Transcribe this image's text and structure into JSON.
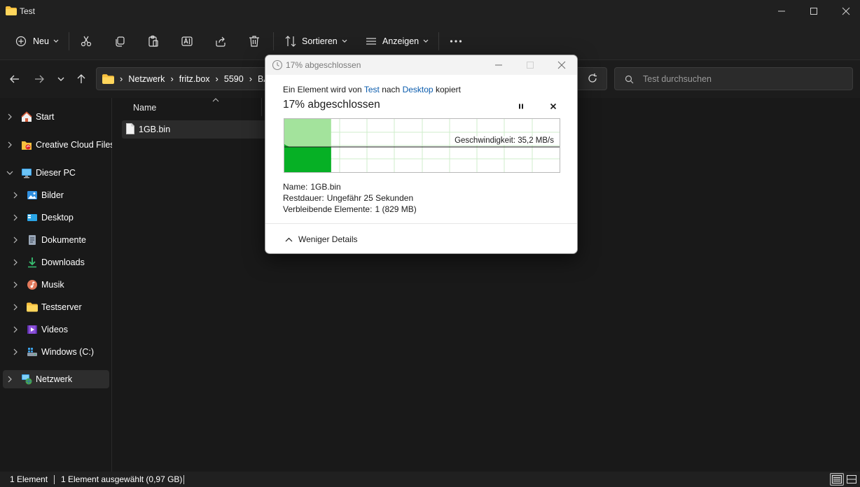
{
  "window": {
    "title": "Test",
    "controls": [
      "minimize",
      "maximize",
      "close"
    ]
  },
  "toolbar": {
    "new_label": "Neu",
    "sort_label": "Sortieren",
    "view_label": "Anzeigen",
    "icons": [
      "cut-icon",
      "copy-icon",
      "paste-icon",
      "rename-icon",
      "share-icon",
      "delete-icon",
      "more-icon"
    ]
  },
  "address": {
    "crumbs": [
      "Netzwerk",
      "fritz.box",
      "5590",
      "BA"
    ]
  },
  "search": {
    "placeholder": "Test durchsuchen"
  },
  "sidebar": {
    "items": [
      {
        "label": "Start",
        "icon": "home-icon",
        "level": 0
      },
      {
        "label": "Creative Cloud Files",
        "icon": "creative-cloud-folder-icon",
        "level": 0
      },
      {
        "label": "Dieser PC",
        "icon": "pc-icon",
        "level": 0,
        "expanded": true
      },
      {
        "label": "Bilder",
        "icon": "pictures-icon",
        "level": 1
      },
      {
        "label": "Desktop",
        "icon": "desktop-icon",
        "level": 1
      },
      {
        "label": "Dokumente",
        "icon": "documents-icon",
        "level": 1
      },
      {
        "label": "Downloads",
        "icon": "downloads-icon",
        "level": 1
      },
      {
        "label": "Musik",
        "icon": "music-icon",
        "level": 1
      },
      {
        "label": "Testserver",
        "icon": "folder-icon",
        "level": 1
      },
      {
        "label": "Videos",
        "icon": "videos-icon",
        "level": 1
      },
      {
        "label": "Windows (C:)",
        "icon": "drive-icon",
        "level": 1
      },
      {
        "label": "Netzwerk",
        "icon": "network-icon",
        "level": 0,
        "selected": true
      }
    ]
  },
  "content": {
    "column_name": "Name",
    "files": [
      {
        "name": "1GB.bin",
        "selected": true
      }
    ]
  },
  "statusbar": {
    "count": "1 Element",
    "selection": "1 Element ausgewählt (0,97 GB)"
  },
  "dialog": {
    "title": "17% abgeschlossen",
    "line_prefix": "Ein Element wird von",
    "source": "Test",
    "line_mid": "nach",
    "destination": "Desktop",
    "line_suffix": "kopiert",
    "heading": "17% abgeschlossen",
    "progress_fraction": 0.17,
    "speed": "Geschwindigkeit: 35,2 MB/s",
    "name_label": "Name:",
    "name_value": "1GB.bin",
    "remaining_time_label": "Restdauer:",
    "remaining_time_value": "Ungefähr 25 Sekunden",
    "remaining_items_label": "Verbleibende Elemente:",
    "remaining_items_value": "1 (829 MB)",
    "less_details": "Weniger Details"
  },
  "colors": {
    "progress_light": "#a3e39c",
    "progress_dark": "#06b025",
    "link": "#0b5cad"
  }
}
